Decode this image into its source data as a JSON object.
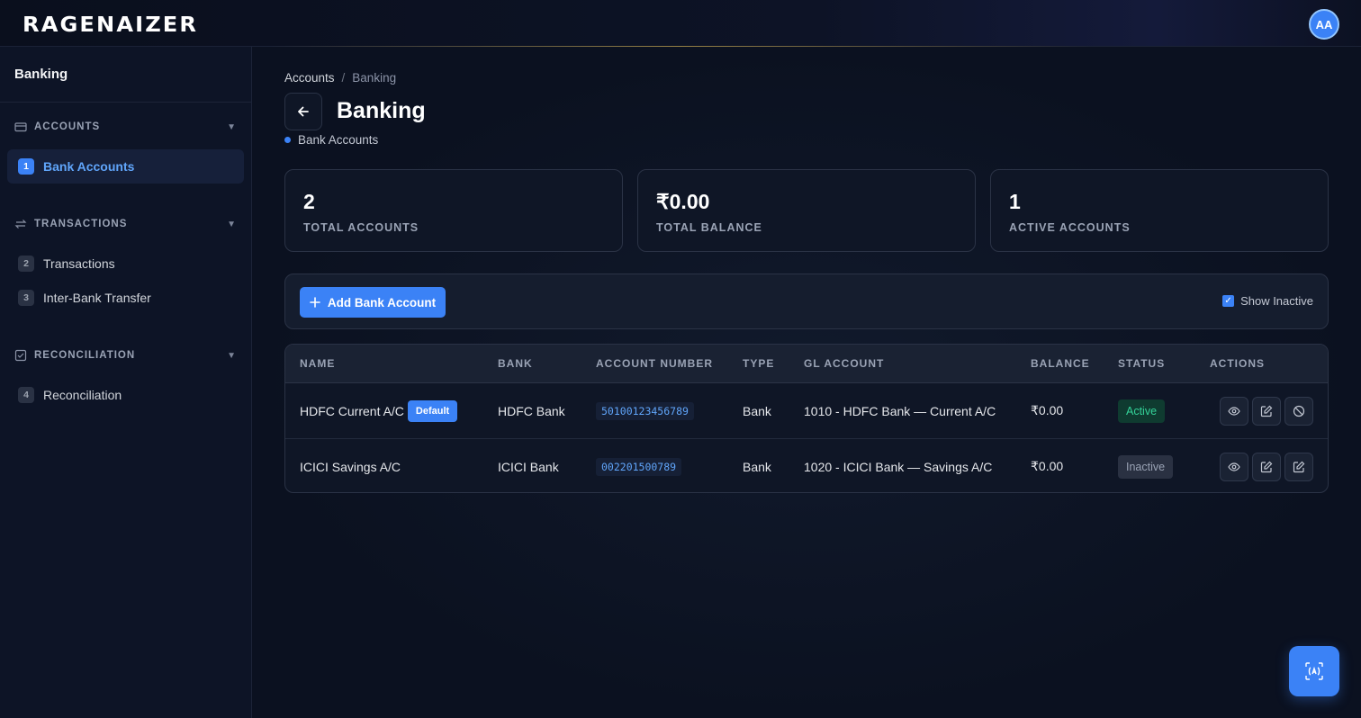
{
  "app": {
    "logo": "RAGENAIZER",
    "avatar_initials": "AA"
  },
  "sidebar": {
    "title": "Banking",
    "sections": [
      {
        "label": "ACCOUNTS",
        "items": [
          {
            "num": "1",
            "label": "Bank Accounts",
            "active": true
          }
        ]
      },
      {
        "label": "TRANSACTIONS",
        "items": [
          {
            "num": "2",
            "label": "Transactions"
          },
          {
            "num": "3",
            "label": "Inter-Bank Transfer"
          }
        ]
      },
      {
        "label": "RECONCILIATION",
        "items": [
          {
            "num": "4",
            "label": "Reconciliation"
          }
        ]
      }
    ]
  },
  "breadcrumb": {
    "root": "Accounts",
    "sep": "/",
    "current": "Banking"
  },
  "page": {
    "title": "Banking",
    "subtitle": "Bank Accounts"
  },
  "stats": [
    {
      "value": "2",
      "label": "TOTAL ACCOUNTS"
    },
    {
      "value": "₹0.00",
      "label": "TOTAL BALANCE"
    },
    {
      "value": "1",
      "label": "ACTIVE ACCOUNTS"
    }
  ],
  "toolbar": {
    "add_label": "Add Bank Account",
    "show_inactive_label": "Show Inactive",
    "show_inactive_checked": true
  },
  "table": {
    "columns": [
      "NAME",
      "BANK",
      "ACCOUNT NUMBER",
      "TYPE",
      "GL ACCOUNT",
      "BALANCE",
      "STATUS",
      "ACTIONS"
    ],
    "rows": [
      {
        "name": "HDFC Current A/C",
        "badge": "Default",
        "bank": "HDFC Bank",
        "account_number": "50100123456789",
        "type": "Bank",
        "gl_account": "1010 - HDFC Bank — Current A/C",
        "balance": "₹0.00",
        "status": "Active"
      },
      {
        "name": "ICICI Savings A/C",
        "badge": "",
        "bank": "ICICI Bank",
        "account_number": "002201500789",
        "type": "Bank",
        "gl_account": "1020 - ICICI Bank — Savings A/C",
        "balance": "₹0.00",
        "status": "Inactive"
      }
    ]
  },
  "colors": {
    "accent": "#3b82f6",
    "active_status": "#34d399",
    "background": "#0b1120"
  },
  "icons": {
    "fab": "ai-assistant-icon"
  }
}
